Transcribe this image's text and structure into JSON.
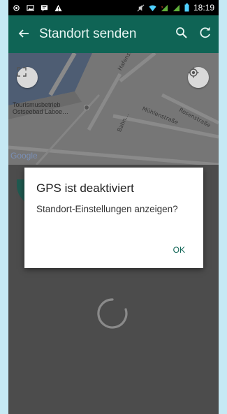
{
  "status_bar": {
    "time": "18:19",
    "left_icons": [
      "location-icon",
      "image-icon",
      "message-icon",
      "warning-icon"
    ],
    "right_icons": [
      "no-mute-icon",
      "wifi-icon",
      "signal-1-icon",
      "signal-2-icon",
      "battery-icon"
    ]
  },
  "app_bar": {
    "title": "Standort senden",
    "back_icon": "arrow-back-icon",
    "actions": [
      "search-icon",
      "refresh-icon"
    ],
    "color": "#0f6455"
  },
  "map": {
    "place_label_line1": "Tourismusbetrieb",
    "place_label_line2": "Ostseebad Laboe…",
    "streets": [
      "Hafenstraße",
      "Mühlenstraße",
      "Rosenstraße",
      "Bahn…"
    ],
    "logo": "Google"
  },
  "dialog": {
    "title": "GPS ist deaktiviert",
    "message": "Standort-Einstellungen anzeigen?",
    "ok_label": "OK"
  }
}
